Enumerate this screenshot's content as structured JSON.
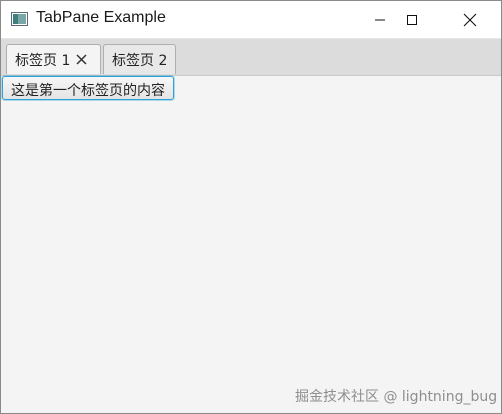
{
  "window": {
    "title": "TabPane Example",
    "app_icon": "java-window-icon",
    "controls": [
      "minimize-icon",
      "maximize-icon",
      "close-icon"
    ]
  },
  "tabs": [
    {
      "label": "标签页 1",
      "closable": true,
      "selected": true
    },
    {
      "label": "标签页 2",
      "closable": false,
      "selected": false
    }
  ],
  "content": {
    "label": "这是第一个标签页的内容"
  },
  "watermark": "掘金技术社区 @ lightning_bug",
  "colors": {
    "accent": "#2ba3d8",
    "tab_header_bg": "#dcdcdc",
    "content_bg": "#f4f4f4"
  }
}
